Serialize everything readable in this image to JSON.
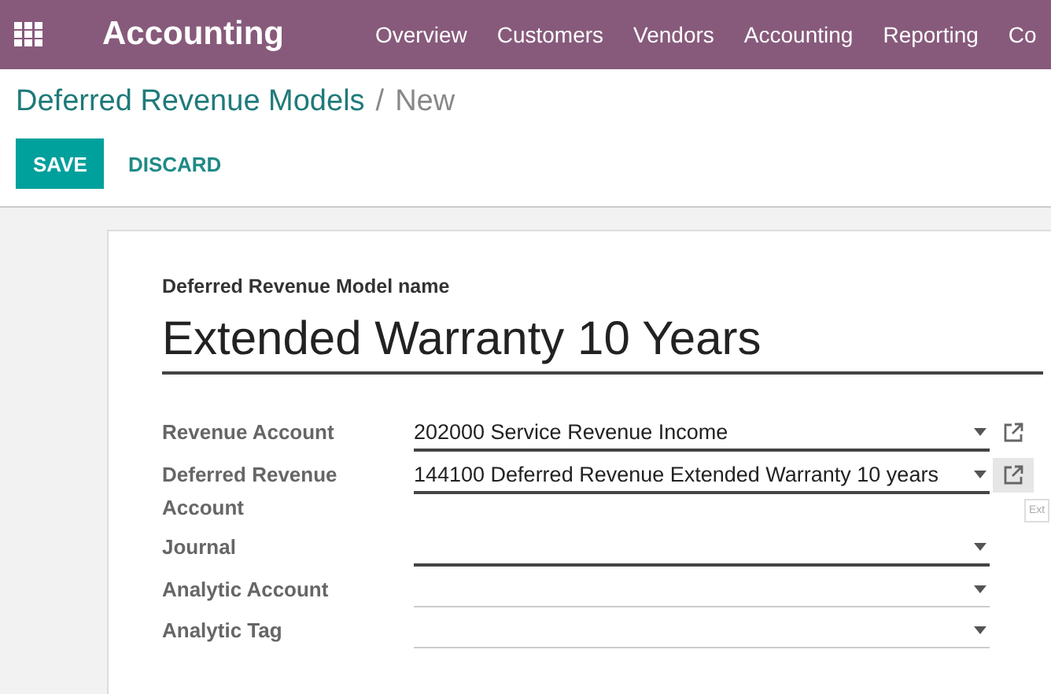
{
  "navbar": {
    "app_name": "Accounting",
    "menu": [
      "Overview",
      "Customers",
      "Vendors",
      "Accounting",
      "Reporting",
      "Co"
    ]
  },
  "breadcrumb": {
    "parent": "Deferred Revenue Models",
    "separator": "/",
    "current": "New"
  },
  "buttons": {
    "save": "SAVE",
    "discard": "DISCARD"
  },
  "form": {
    "name_label": "Deferred Revenue Model name",
    "name_value": "Extended Warranty 10 Years",
    "fields": [
      {
        "label": "Revenue Account",
        "value": "202000 Service Revenue Income",
        "required": true,
        "link": {
          "hovered": false
        }
      },
      {
        "label": "Deferred Revenue Account",
        "value": "144100 Deferred Revenue Extended Warranty 10 years",
        "required": true,
        "link": {
          "hovered": true,
          "tooltip": "Ext"
        }
      },
      {
        "label": "Journal",
        "required": true
      },
      {
        "label": "Analytic Account",
        "required": false
      },
      {
        "label": "Analytic Tag",
        "required": false
      }
    ]
  }
}
